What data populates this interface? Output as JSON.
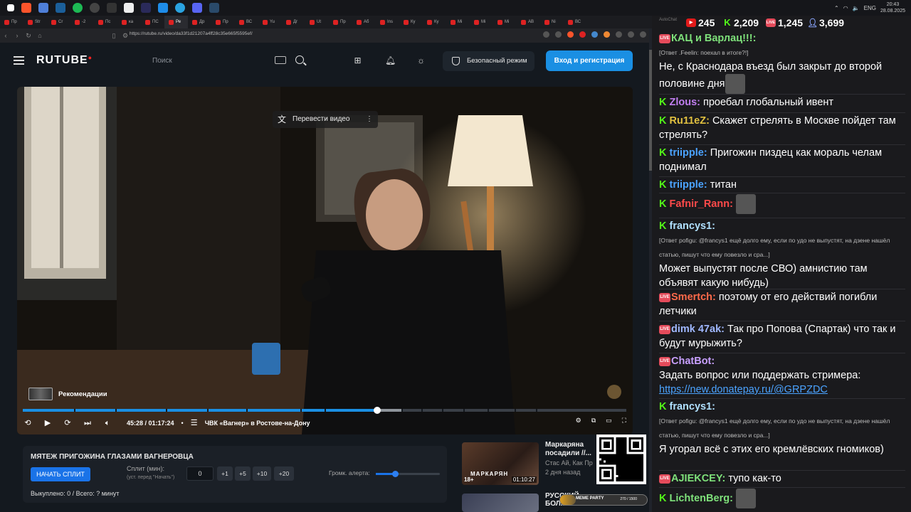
{
  "colors": {
    "accent": "#1a8fe3",
    "kick_green": "#53fc18",
    "vk_live": "#e54b5b",
    "youtube_red": "#e21a1a"
  },
  "taskbar": {
    "icons": [
      "windows-icon",
      "brave-icon",
      "chrome-icon",
      "steam-icon",
      "spotify-icon",
      "obs-icon",
      "terminal-icon",
      "capcut-icon",
      "ae-icon",
      "edge-icon",
      "telegram-icon",
      "discord-icon",
      "steam2-icon"
    ],
    "lang": "ENG",
    "time": "20:43",
    "date": "28.08.2025"
  },
  "browser": {
    "tabs": [
      {
        "label": "Пр",
        "active": false
      },
      {
        "label": "Str",
        "active": false
      },
      {
        "label": "Cr",
        "active": false
      },
      {
        "label": "-2",
        "active": false
      },
      {
        "label": "Пс",
        "active": false
      },
      {
        "label": "ка",
        "active": false
      },
      {
        "label": "ПС",
        "active": false
      },
      {
        "label": "Ре",
        "active": true
      },
      {
        "label": "Др",
        "active": false
      },
      {
        "label": "Пр",
        "active": false
      },
      {
        "label": "ВС",
        "active": false
      },
      {
        "label": "Yu",
        "active": false
      },
      {
        "label": "Дг",
        "active": false
      },
      {
        "label": "Ut",
        "active": false
      },
      {
        "label": "Пр",
        "active": false
      },
      {
        "label": "Аб",
        "active": false
      },
      {
        "label": "Ins",
        "active": false
      },
      {
        "label": "Ку",
        "active": false
      },
      {
        "label": "Ку",
        "active": false
      },
      {
        "label": "Mi",
        "active": false
      },
      {
        "label": "Mi",
        "active": false
      },
      {
        "label": "Mi",
        "active": false
      },
      {
        "label": "АВ",
        "active": false
      },
      {
        "label": "Ni",
        "active": false
      },
      {
        "label": "ВС",
        "active": false
      }
    ],
    "new_tab": "+",
    "url": "https://rutube.ru/video/da33f1d21207a4ff28c35e665f5595ef/"
  },
  "site": {
    "logo": "RUTUBE",
    "search_placeholder": "Поиск",
    "safe_mode": "Безопасный режим",
    "login": "Вход и регистрация"
  },
  "player": {
    "translate": "Перевести видео",
    "recommendations": "Рекомендации",
    "time": "45:28 / 01:17:24",
    "chapter": "ЧВК «Вагнер» в Ростове-на-Дону",
    "progress": 0.587,
    "buffered": 0.627,
    "chapter_marks": [
      0.085,
      0.153,
      0.237,
      0.305,
      0.37,
      0.46,
      0.5,
      0.627,
      0.66,
      0.695,
      0.73,
      0.77,
      0.815,
      0.85
    ]
  },
  "split": {
    "title": "МЯТЕЖ ПРИГОЖИНА ГЛАЗАМИ ВАГНЕРОВЦА",
    "start_button": "НАЧАТЬ СПЛИТ",
    "minutes_label": "Сплит (мин):",
    "minutes_hint": "(уст. перед \"Начать\")",
    "value": "0",
    "buttons": [
      "+1",
      "+5",
      "+10",
      "+20"
    ],
    "alert_volume_label": "Громк. алерта:",
    "alert_volume": 0.3,
    "spent": "Выкуплено: 0 / Всего: ? минут"
  },
  "related": [
    {
      "title": "Маркаряна посадили //...",
      "channel": "Стас Ай, Как Пр",
      "ago": "2 дня назад",
      "age": "18+",
      "duration": "01:10:27",
      "banner": "МАРКАРЯН"
    },
    {
      "title": "РУССКИЙ БОЛ..."
    }
  ],
  "donate_bar": {
    "label": "MEME PARTY",
    "count": "270 / 1500",
    "fill": 0.18
  },
  "chat": {
    "app": "AutoChat",
    "stats": {
      "youtube": "245",
      "kick": "2,209",
      "vk": "1,245",
      "twitch": "3,699"
    },
    "messages": [
      {
        "platform": "vk",
        "name": "КАЦ и Варлац!!!:",
        "color": "#7ee07a",
        "reply": "[Ответ .Feelin: поехал в итоге?!]",
        "text": "Не, с Краснодара въезд был закрыт до второй половине дня",
        "emote": true
      },
      {
        "platform": "kick",
        "name": "Zlous:",
        "color": "#c07ef0",
        "text": "проебал глобальный ивент"
      },
      {
        "platform": "kick",
        "name": "Ru11eZ:",
        "color": "#e0c040",
        "text": "Скажет стрелять в Москве пойдет там стрелять?"
      },
      {
        "platform": "kick",
        "name": "triipple:",
        "color": "#4ba3ff",
        "text": "Пригожин пиздец как мораль челам поднимал"
      },
      {
        "platform": "kick",
        "name": "triipple:",
        "color": "#4ba3ff",
        "text": "титан"
      },
      {
        "platform": "kick",
        "name": "Fafnir_Rann:",
        "color": "#ff4a4a",
        "text": "",
        "emote": true
      },
      {
        "platform": "kick",
        "name": "francys1:",
        "color": "#b0e0ff",
        "reply": "[Ответ pofigu: @francys1 ещё долго ему, если по удо не выпустят, на дзене нашёл статью, пишут что ему повезло и сра...]",
        "text": "Может выпустят после СВО) амнистию там объявят какую нибудь)"
      },
      {
        "platform": "vk",
        "name": "Smertch:",
        "color": "#ff6a4a",
        "text": "поэтому от его действий погибли летчики"
      },
      {
        "platform": "vk",
        "name": "dimk 47ak:",
        "color": "#a0b8ff",
        "text": "Так про Попова (Спартак) что так и будут мурыжить?"
      },
      {
        "platform": "vk",
        "name": "ChatBot:",
        "color": "#c8a0ff",
        "text": "Задать вопрос или поддержать стримера:",
        "link": "https://new.donatepay.ru/@GRPZDC"
      },
      {
        "platform": "kick",
        "name": "francys1:",
        "color": "#b0e0ff",
        "reply": "[Ответ pofigu: @francys1 ещё долго ему, если по удо не выпустят, на дзене нашёл статью, пишут что ему повезло и сра...]",
        "text": "Я угорал всё с этих его кремлёвских гномиков)"
      },
      {
        "platform": "vk",
        "name": "AJIEKCEY:",
        "color": "#7ee07a",
        "text": "тупо как-то"
      },
      {
        "platform": "kick",
        "name": "LichtenBerg:",
        "color": "#7ee07a",
        "text": "",
        "emote": true
      }
    ]
  }
}
